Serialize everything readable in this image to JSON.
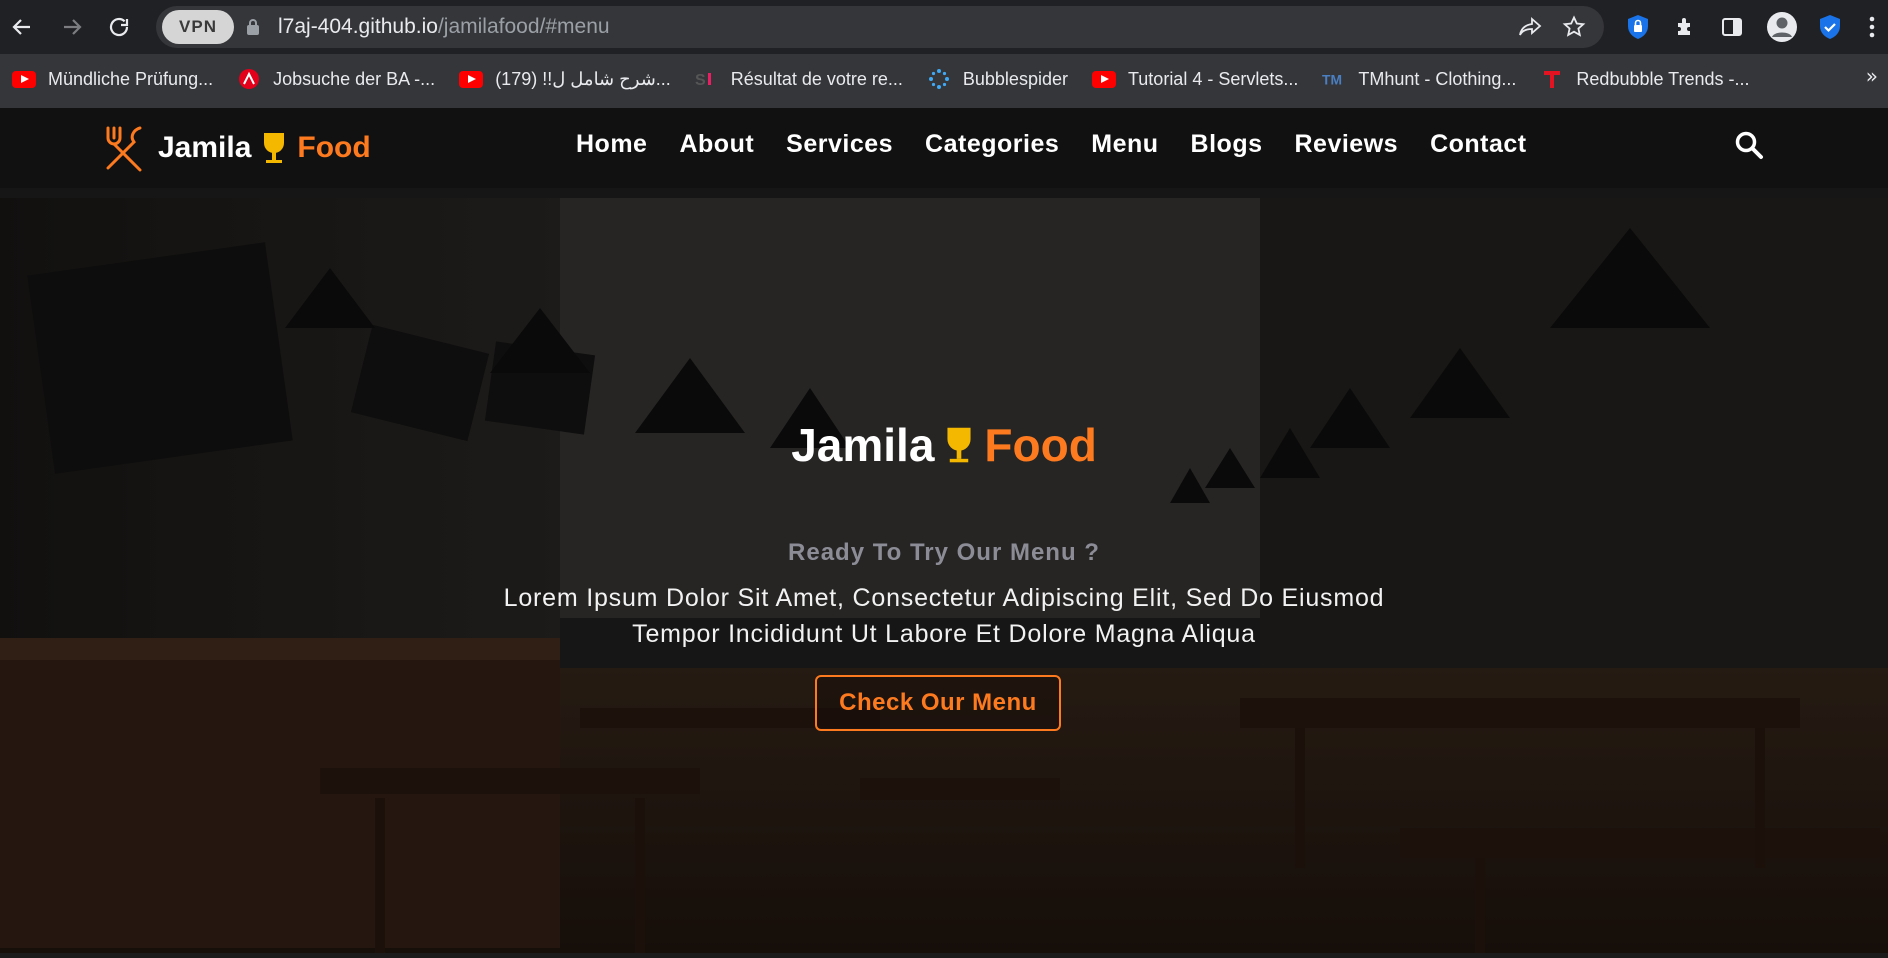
{
  "browser": {
    "vpn_label": "VPN",
    "url_host": "l7aj-404.github.io",
    "url_path": "/jamilafood/#menu",
    "bookmarks": [
      {
        "label": "Mündliche Prüfung...",
        "icon": "youtube-icon"
      },
      {
        "label": "Jobsuche der BA -...",
        "icon": "arbeitsagentur-icon"
      },
      {
        "label": "(179) !!شرح شامل ل...",
        "icon": "youtube-icon"
      },
      {
        "label": "Résultat de votre re...",
        "icon": "si-icon"
      },
      {
        "label": "Bubblespider",
        "icon": "bubblespider-icon"
      },
      {
        "label": "Tutorial 4 - Servlets...",
        "icon": "youtube-icon"
      },
      {
        "label": "TMhunt - Clothing...",
        "icon": "tm-icon"
      },
      {
        "label": "Redbubble Trends -...",
        "icon": "redbubble-icon"
      }
    ],
    "more_label": "»"
  },
  "site": {
    "logo": {
      "word1": "Jamila",
      "word2": "Food"
    },
    "nav": [
      "Home",
      "About",
      "Services",
      "Categories",
      "Menu",
      "Blogs",
      "Reviews",
      "Contact"
    ],
    "accent_color": "#fd7a1f",
    "logo_glass_color": "#f5b800"
  },
  "hero": {
    "title_word1": "Jamila",
    "title_word2": "Food",
    "kicker": "Ready To Try Our Menu ?",
    "desc_line1": "Lorem Ipsum Dolor Sit Amet, Consectetur Adipiscing Elit, Sed Do Eiusmod",
    "desc_line2": "Tempor Incididunt Ut Labore Et Dolore Magna Aliqua",
    "button": "Check Our Menu"
  }
}
